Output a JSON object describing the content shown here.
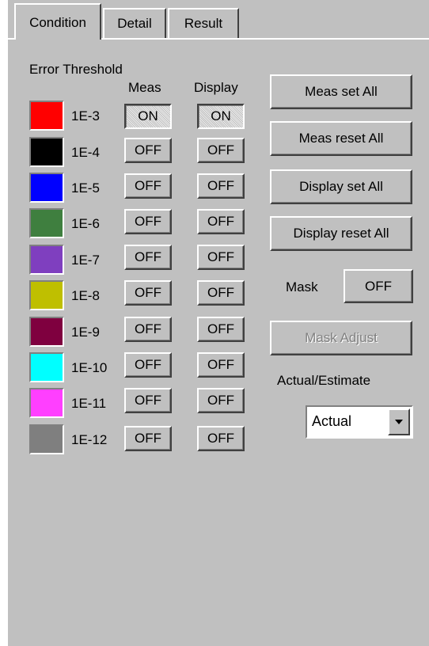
{
  "tabs": [
    {
      "label": "Condition",
      "active": true
    },
    {
      "label": "Detail",
      "active": false
    },
    {
      "label": "Result",
      "active": false
    }
  ],
  "threshold": {
    "heading": "Error Threshold",
    "col_meas": "Meas",
    "col_display": "Display",
    "rows": [
      {
        "label": "1E-3",
        "color": "#ff0000",
        "meas": "ON",
        "display": "ON"
      },
      {
        "label": "1E-4",
        "color": "#000000",
        "meas": "OFF",
        "display": "OFF"
      },
      {
        "label": "1E-5",
        "color": "#0000ff",
        "meas": "OFF",
        "display": "OFF"
      },
      {
        "label": "1E-6",
        "color": "#3f7f3f",
        "meas": "OFF",
        "display": "OFF"
      },
      {
        "label": "1E-7",
        "color": "#7f3fbf",
        "meas": "OFF",
        "display": "OFF"
      },
      {
        "label": "1E-8",
        "color": "#bfbf00",
        "meas": "OFF",
        "display": "OFF"
      },
      {
        "label": "1E-9",
        "color": "#7f003f",
        "meas": "OFF",
        "display": "OFF"
      },
      {
        "label": "1E-10",
        "color": "#00ffff",
        "meas": "OFF",
        "display": "OFF"
      },
      {
        "label": "1E-11",
        "color": "#ff3fff",
        "meas": "OFF",
        "display": "OFF"
      },
      {
        "label": "1E-12",
        "color": "#7f7f7f",
        "meas": "OFF",
        "display": "OFF"
      }
    ]
  },
  "actions": {
    "meas_set_all": "Meas set All",
    "meas_reset_all": "Meas reset All",
    "display_set_all": "Display set All",
    "display_reset_all": "Display reset All"
  },
  "mask": {
    "label": "Mask",
    "value": "OFF",
    "adjust_label": "Mask Adjust"
  },
  "estimate": {
    "label": "Actual/Estimate",
    "selected": "Actual"
  }
}
